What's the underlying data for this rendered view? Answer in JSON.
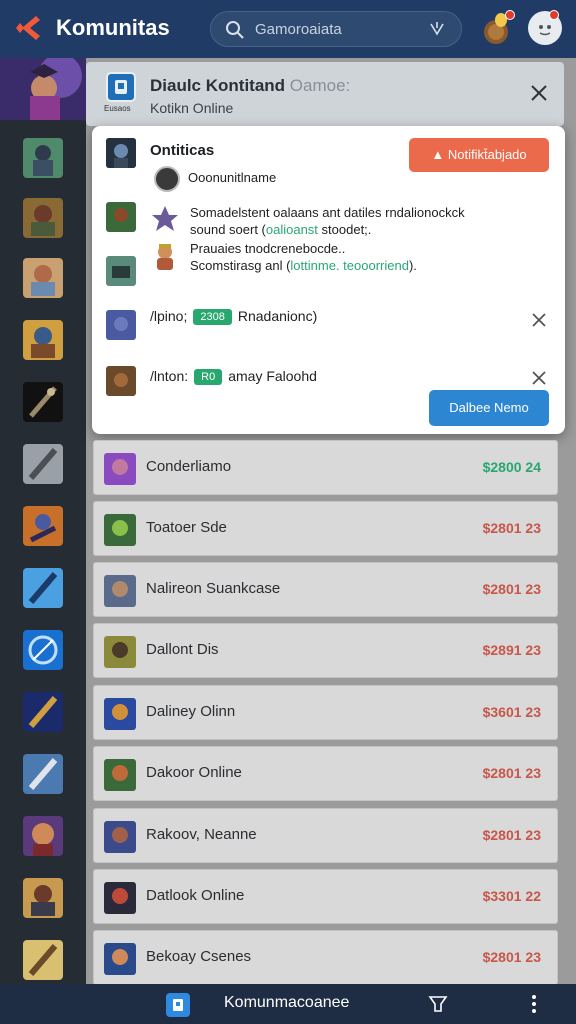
{
  "app": {
    "title": "Komunitas"
  },
  "search": {
    "placeholder": "Gamoroaiata"
  },
  "colors": {
    "topbar": "#203c66",
    "accent_red": "#ea6a4b",
    "accent_blue": "#2d86d2",
    "price_green": "#28a86e",
    "price_red": "#c8564a"
  },
  "header_card": {
    "title": "Diaulc Kontitand",
    "title_suffix": "Oamoe:",
    "subtitle": "Kotikn Online",
    "icon_label": "Eusaos"
  },
  "popup": {
    "title": "Ontiticas",
    "owner": "Ooonunitlname",
    "action_button": "Notifikt̄abjado",
    "entry1_line1": "Somadelstent oalaans ant datiles rndalionockck",
    "entry1_line2_pre": "sound soert (",
    "entry1_line2_hl": "oalioanst",
    "entry1_line2_post": " stoodet;.",
    "entry2_line1": "Prauaies tnodcrenebocde..",
    "entry2_line2_pre": "Scomstirasg anl (",
    "entry2_line2_hl": "lottinme. teooorriend",
    "entry2_line2_post": ").",
    "row1_prefix": "/lpino;",
    "row1_tag": "2308",
    "row1_text": "Rnadanionc)",
    "row2_prefix": "/lnton:",
    "row2_tag": "R0",
    "row2_text": "amay Faloohd",
    "confirm_button": "Dalbee Nemo"
  },
  "list": [
    {
      "name": "Conderliamo",
      "price": "$2800 24",
      "color": "green"
    },
    {
      "name": "Toatoer Sde",
      "price": "$2801 23",
      "color": "red"
    },
    {
      "name": "Nalireon Suankcase",
      "price": "$2801 23",
      "color": "red"
    },
    {
      "name": "Dallont Dis",
      "price": "$2891 23",
      "color": "red"
    },
    {
      "name": "Daliney Olinn",
      "price": "$3601 23",
      "color": "red"
    },
    {
      "name": "Dakoor Online",
      "price": "$2801 23",
      "color": "red"
    },
    {
      "name": "Rakoov, Neanne",
      "price": "$2801 23",
      "color": "red"
    },
    {
      "name": "Datlook Online",
      "price": "$3301 22",
      "color": "red"
    },
    {
      "name": "Bekoay Csenes",
      "price": "$2801 23",
      "color": "red"
    }
  ],
  "bottombar": {
    "label": "Komunmacoanee"
  }
}
